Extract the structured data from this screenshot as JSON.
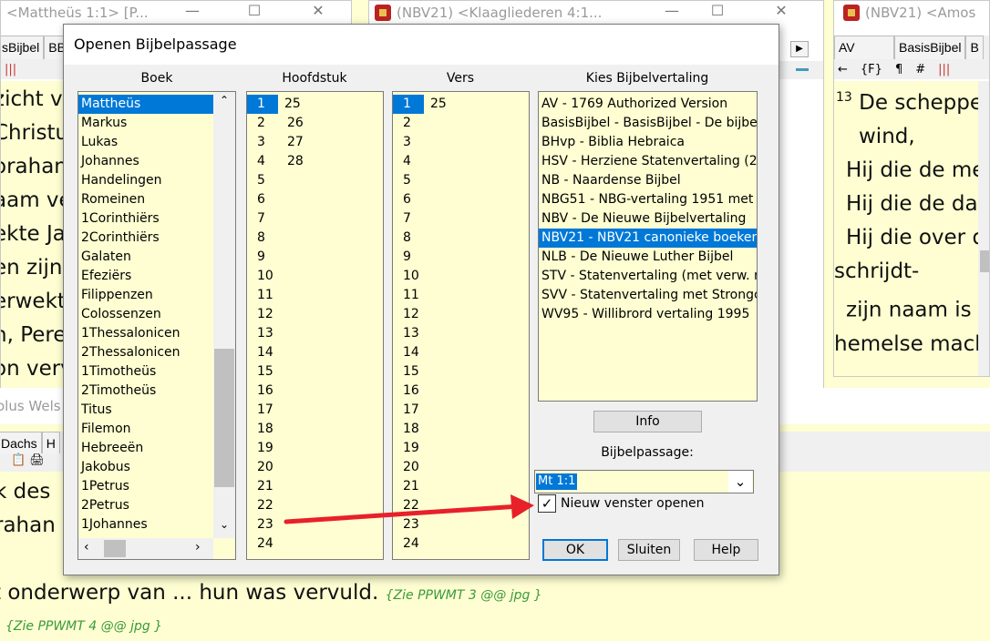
{
  "windows": {
    "left": {
      "title": "<Mattheüs 1:1> [P...",
      "tabs": [
        "sBijbel",
        "BB"
      ],
      "text_lines": [
        "zicht va",
        "Christu",
        "orahan",
        "aam ver",
        "ekte Jak",
        "en zijn",
        "erwekt",
        "n, Peres",
        "on verv"
      ]
    },
    "middle": {
      "title": "(NBV21) <Klaagliederen 4:1..."
    },
    "right": {
      "title": "(NBV21) <Amos",
      "tabs": [
        "AV",
        "BasisBijbel",
        "B"
      ],
      "toolbar": [
        "←",
        "{F}",
        "¶",
        "#"
      ],
      "verse_number": "13",
      "first_line": "De scheppe",
      "text_lines": [
        "wind,",
        "Hij die de me",
        "Hij die de dag",
        "Hij die over d",
        "schrijdt-",
        "zijn naam is",
        "hemelse macht"
      ],
      "inline_marker": "H"
    }
  },
  "bottom": {
    "bar_text": "olus Wels",
    "tabs": [
      "Dachs",
      "H"
    ],
    "lines": [
      "k des ",
      "rahan"
    ],
    "line_main": "t onderwerp van  ...  hun was vervuld.",
    "ref1": "{Zie PPWMT 3 @@ jpg }",
    "ref2": "{Zie PPWMT 4 @@ jpg }"
  },
  "dialog": {
    "title": "Openen Bijbelpassage",
    "headers": {
      "boek": "Boek",
      "hoofdstuk": "Hoofdstuk",
      "vers": "Vers",
      "vertaling": "Kies Bijbelvertaling"
    },
    "books": [
      "Mattheüs",
      "Markus",
      "Lukas",
      "Johannes",
      "Handelingen",
      "Romeinen",
      "1Corinthiërs",
      "2Corinthiërs",
      "Galaten",
      "Efeziërs",
      "Filippenzen",
      "Colossenzen",
      "1Thessalonicen",
      "2Thessalonicen",
      "1Timotheüs",
      "2Timotheüs",
      "Titus",
      "Filemon",
      "Hebreeën",
      "Jakobus",
      "1Petrus",
      "2Petrus",
      "1Johannes"
    ],
    "selected_book": "Mattheüs",
    "chapters_col1": [
      "1",
      "2",
      "3",
      "4",
      "5",
      "6",
      "7",
      "8",
      "9",
      "10",
      "11",
      "12",
      "13",
      "14",
      "15",
      "16",
      "17",
      "18",
      "19",
      "20",
      "21",
      "22",
      "23",
      "24"
    ],
    "chapters_col2": [
      "25",
      "26",
      "27",
      "28"
    ],
    "verses_col1": [
      "1",
      "2",
      "3",
      "4",
      "5",
      "6",
      "7",
      "8",
      "9",
      "10",
      "11",
      "12",
      "13",
      "14",
      "15",
      "16",
      "17",
      "18",
      "19",
      "20",
      "21",
      "22",
      "23",
      "24"
    ],
    "verses_col2": [
      "25"
    ],
    "translations": [
      "AV - 1769 Authorized Version",
      "BasisBijbel - BasisBijbel - De bijbel",
      "BHvp - Biblia Hebraica",
      "HSV - Herziene Statenvertaling (20",
      "NB - Naardense Bijbel",
      "NBG51 - NBG-vertaling 1951 met",
      "NBV - De Nieuwe Bijbelvertaling",
      "NBV21 - NBV21 canonieke boeken",
      "NLB - De Nieuwe Luther Bijbel",
      "STV - Statenvertaling (met verw. n",
      "SVV - Statenvertaling met Strongc",
      "WV95 - Willibrord vertaling 1995"
    ],
    "selected_translation": "NBV21 - NBV21 canonieke boeken",
    "info_button": "Info",
    "passage_label": "Bijbelpassage:",
    "passage_value": "Mt 1:1",
    "new_window_label": "Nieuw venster openen",
    "new_window_checked": true,
    "ok_button": "OK",
    "close_button": "Sluiten",
    "help_button": "Help"
  },
  "colors": {
    "text_bg": "#fefed2",
    "selection": "#0078d7",
    "arrow": "#e8202a",
    "ref_green": "#3a9a3a"
  }
}
